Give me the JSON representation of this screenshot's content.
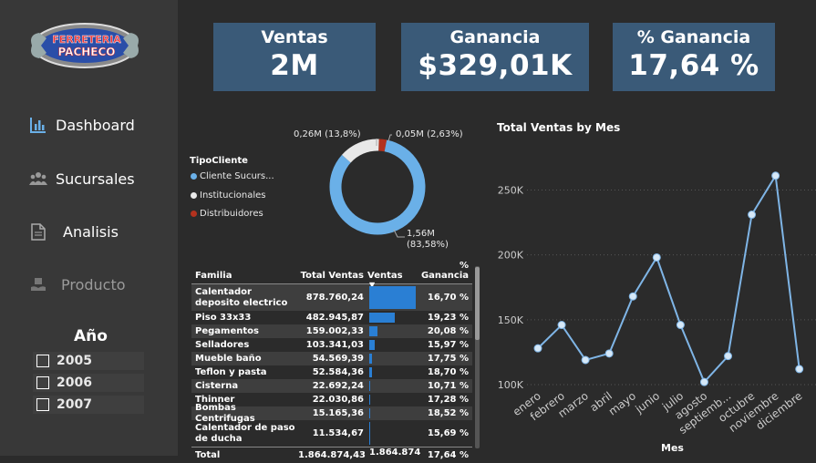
{
  "logo": {
    "line1": "FERRETERIA",
    "line2": "PACHECO"
  },
  "nav": {
    "dashboard": "Dashboard",
    "sucursales": "Sucursales",
    "analisis": "Analisis",
    "producto": "Producto"
  },
  "year_filter": {
    "title": "Año",
    "options": [
      {
        "label": "2005",
        "checked": false
      },
      {
        "label": "2006",
        "checked": false
      },
      {
        "label": "2007",
        "checked": false
      }
    ]
  },
  "kpis": [
    {
      "title": "Ventas",
      "value": "2M"
    },
    {
      "title": "Ganancia",
      "value": "$329,01K"
    },
    {
      "title": "% Ganancia",
      "value": "17,64 %"
    }
  ],
  "donut": {
    "legend_title": "TipoCliente",
    "slices": [
      {
        "name": "Cliente Sucurs...",
        "value": 1.56,
        "pct": 83.58,
        "color": "#6ab0e8",
        "label": "1,56M",
        "label2": "(83,58%)"
      },
      {
        "name": "Institucionales",
        "value": 0.26,
        "pct": 13.8,
        "color": "#e8e8e8",
        "label": "0,26M (13,8%)"
      },
      {
        "name": "Distribuidores",
        "value": 0.05,
        "pct": 2.63,
        "color": "#b3321e",
        "label": "0,05M (2,63%)"
      }
    ]
  },
  "table": {
    "headers": [
      "Familia",
      "Total Ventas",
      "Ventas",
      "% Ganancia"
    ],
    "rows": [
      {
        "familia": "Calentador deposito electrico",
        "total": "878.760,24",
        "ventas": 878760.24,
        "pct": "16,70 %"
      },
      {
        "familia": "Piso 33x33",
        "total": "482.945,87",
        "ventas": 482945.87,
        "pct": "19,23 %"
      },
      {
        "familia": "Pegamentos",
        "total": "159.002,33",
        "ventas": 159002.33,
        "pct": "20,08 %"
      },
      {
        "familia": "Selladores",
        "total": "103.341,03",
        "ventas": 103341.03,
        "pct": "15,97 %"
      },
      {
        "familia": "Mueble baño",
        "total": "54.569,39",
        "ventas": 54569.39,
        "pct": "17,75 %"
      },
      {
        "familia": "Teflon y pasta",
        "total": "52.584,36",
        "ventas": 52584.36,
        "pct": "18,70 %"
      },
      {
        "familia": "Cisterna",
        "total": "22.692,24",
        "ventas": 22692.24,
        "pct": "10,71 %"
      },
      {
        "familia": "Thinner",
        "total": "22.030,86",
        "ventas": 22030.86,
        "pct": "17,28 %"
      },
      {
        "familia": "Bombas Centrifugas",
        "total": "15.165,36",
        "ventas": 15165.36,
        "pct": "18,52 %"
      },
      {
        "familia": "Calentador de paso de ducha",
        "total": "11.534,67",
        "ventas": 11534.67,
        "pct": "15,69 %"
      }
    ],
    "total": {
      "label": "Total",
      "total": "1.864.874,43",
      "ventas": "1.864.874",
      "pct": "17,64 %"
    }
  },
  "chart_data": {
    "type": "line",
    "title": "Total Ventas by Mes",
    "xlabel": "Mes",
    "ylabel": "",
    "categories": [
      "enero",
      "febrero",
      "marzo",
      "abril",
      "mayo",
      "junio",
      "julio",
      "agosto",
      "septiemb...",
      "octubre",
      "noviembre",
      "diciembre"
    ],
    "values": [
      128000,
      146000,
      119000,
      124000,
      168000,
      198000,
      146000,
      102000,
      122000,
      231000,
      261000,
      112000
    ],
    "yticks": [
      100000,
      150000,
      200000,
      250000
    ],
    "ytick_labels": [
      "100K",
      "150K",
      "200K",
      "250K"
    ],
    "ylim": [
      100000,
      270000
    ],
    "color": "#7fb5e6"
  }
}
